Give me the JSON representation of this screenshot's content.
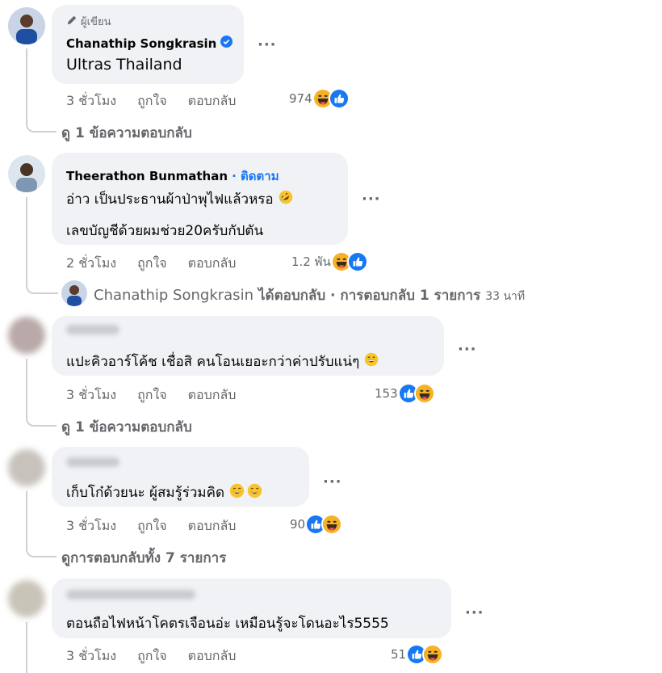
{
  "comments": [
    {
      "author_badge": "ผู้เขียน",
      "author": "Chanathip Songkrasin",
      "text": "Ultras Thailand",
      "time": "3 ชั่วโมง",
      "like": "ถูกใจ",
      "reply": "ตอบกลับ",
      "reaction_count": "974",
      "replies_link": "ดู 1 ข้อความตอบกลับ"
    },
    {
      "author": "Theerathon Bunmathan",
      "follow": "· ติดตาม",
      "text_line1": "อ่าว เป็นประธานผ้าป่าพุไฟแล้วหรอ",
      "text_line2": "เลขบัญชีด้วยผมช่วย20ครับกัปตัน",
      "time": "2 ชั่วโมง",
      "like": "ถูกใจ",
      "reply": "ตอบกลับ",
      "reaction_count": "1.2 พัน",
      "reply_preview": {
        "author": "Chanathip Songkrasin",
        "text": "ได้ตอบกลับ · การตอบกลับ 1 รายการ",
        "time": "33 นาที"
      }
    },
    {
      "text": "แปะคิวอาร์โค้ช เชื่อสิ คนโอนเยอะกว่าค่าปรับแน่ๆ",
      "time": "3 ชั่วโมง",
      "like": "ถูกใจ",
      "reply": "ตอบกลับ",
      "reaction_count": "153",
      "replies_link": "ดู 1 ข้อความตอบกลับ"
    },
    {
      "text": "เก็บโก๋ด้วยนะ ผู้สมรู้ร่วมคิด",
      "time": "3 ชั่วโมง",
      "like": "ถูกใจ",
      "reply": "ตอบกลับ",
      "reaction_count": "90",
      "replies_link": "ดูการตอบกลับทั้ง 7 รายการ"
    },
    {
      "text": "ตอนถือไฟหน้าโคตรเจือนอ่ะ เหมือนรู้จะโดนอะไร5555",
      "time": "3 ชั่วโมง",
      "like": "ถูกใจ",
      "reply": "ตอบกลับ",
      "reaction_count": "51"
    }
  ],
  "more_glyph": "···",
  "icons": {
    "verified": "verified-badge-icon",
    "author_badge": "pencil-icon",
    "haha": "haha-reaction-icon",
    "like": "like-reaction-icon",
    "laugh_emoji": "rolling-laugh-emoji-icon",
    "grin_emoji": "grin-emoji-icon"
  },
  "colors": {
    "bubble": "#f0f2f5",
    "secondary_text": "#65676b",
    "link_blue": "#1877f2",
    "thread_line": "#ced0d4"
  }
}
